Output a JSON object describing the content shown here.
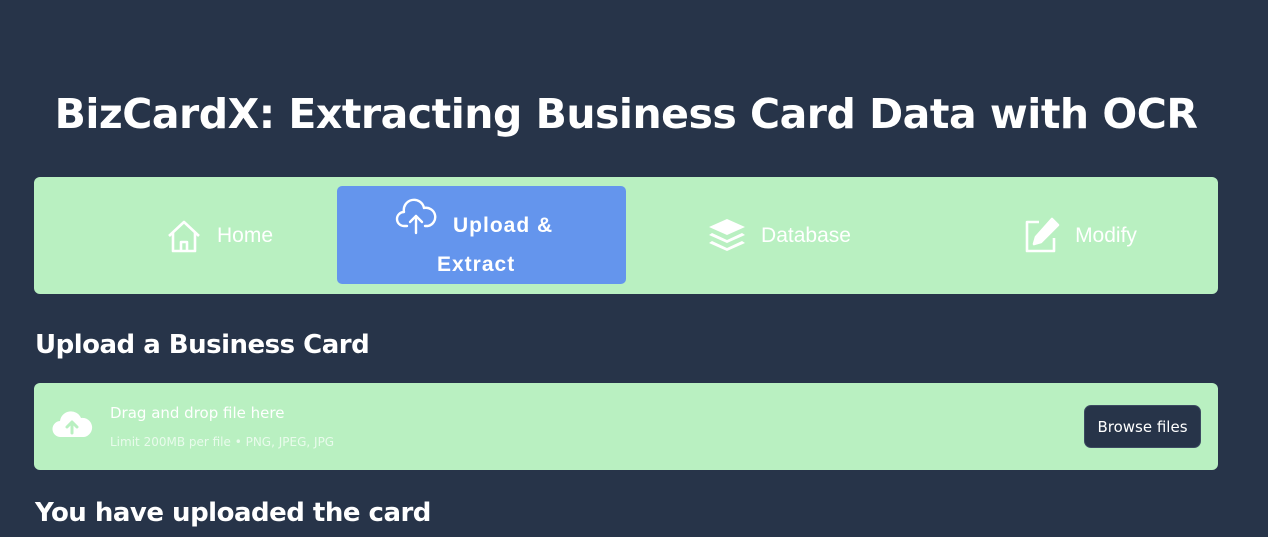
{
  "page": {
    "title": "BizCardX: Extracting Business Card Data with OCR"
  },
  "nav": {
    "items": [
      {
        "label": "Home",
        "icon": "house-icon"
      },
      {
        "label_line1": "Upload &",
        "label_line2": "Extract",
        "icon": "cloud-upload-icon",
        "selected": true
      },
      {
        "label": "Database",
        "icon": "layers-icon"
      },
      {
        "label": "Modify",
        "icon": "pencil-square-icon"
      }
    ],
    "colors": {
      "bar_bg": "#b9f0c1",
      "selected_bg": "#6495ed"
    }
  },
  "upload_section": {
    "heading": "Upload a Business Card",
    "dropzone": {
      "icon": "cloud-upload-icon",
      "primary_text": "Drag and drop file here",
      "secondary_text": "Limit 200MB per file • PNG, JPEG, JPG",
      "browse_label": "Browse files"
    }
  },
  "result_section": {
    "heading": "You have uploaded the card"
  },
  "colors": {
    "page_bg": "#273449",
    "text": "#ffffff"
  }
}
